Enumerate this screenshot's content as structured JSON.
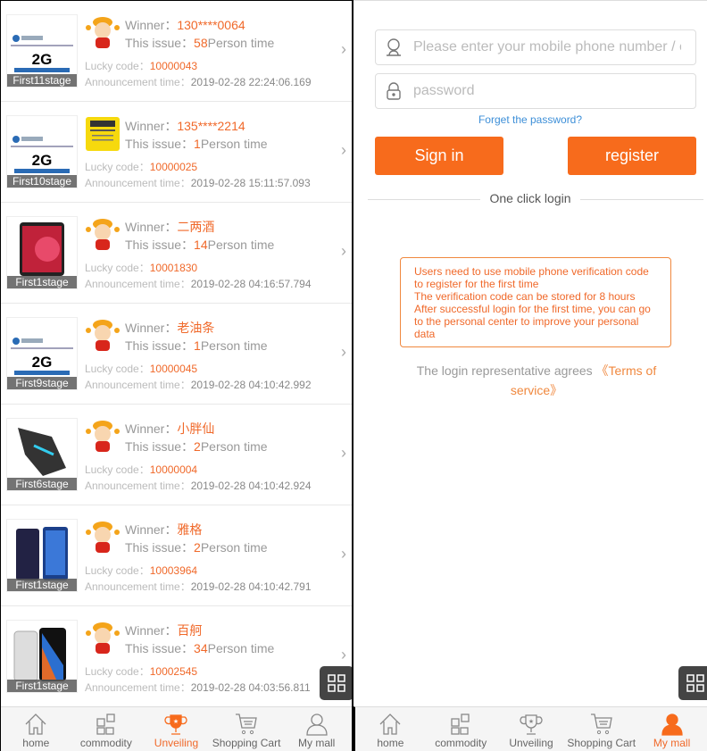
{
  "labels": {
    "winner": "Winner：",
    "issue": "This issue：",
    "person_time": "Person time",
    "lucky": "Lucky code：",
    "announce": "Announcement time："
  },
  "items": [
    {
      "stage": "First11stage",
      "winner": "130****0064",
      "count": "58",
      "code": "10000043",
      "time": "2019-02-28 22:24:06.169",
      "img": "2g-card",
      "avatar": "mascot"
    },
    {
      "stage": "First10stage",
      "winner": "135****2214",
      "count": "1",
      "code": "10000025",
      "time": "2019-02-28 15:11:57.093",
      "img": "2g-card",
      "avatar": "yellow"
    },
    {
      "stage": "First1stage",
      "winner": "二两酒",
      "count": "14",
      "code": "10001830",
      "time": "2019-02-28 04:16:57.794",
      "img": "ipad",
      "avatar": "mascot"
    },
    {
      "stage": "First9stage",
      "winner": "老油条",
      "count": "1",
      "code": "10000045",
      "time": "2019-02-28 04:10:42.992",
      "img": "2g-card",
      "avatar": "mascot"
    },
    {
      "stage": "First6stage",
      "winner": "小胖仙",
      "count": "2",
      "code": "10000004",
      "time": "2019-02-28 04:10:42.924",
      "img": "mouse",
      "avatar": "mascot"
    },
    {
      "stage": "First1stage",
      "winner": "雅格",
      "count": "2",
      "code": "10003964",
      "time": "2019-02-28 04:10:42.791",
      "img": "phone-blue",
      "avatar": "mascot"
    },
    {
      "stage": "First1stage",
      "winner": "百舸",
      "count": "34",
      "code": "10002545",
      "time": "2019-02-28 04:03:56.811",
      "img": "iphone",
      "avatar": "mascot"
    }
  ],
  "nav": [
    {
      "label": "home",
      "icon": "home-icon"
    },
    {
      "label": "commodity",
      "icon": "grid-icon"
    },
    {
      "label": "Unveiling",
      "icon": "trophy-icon"
    },
    {
      "label": "Shopping Cart",
      "icon": "cart-icon"
    },
    {
      "label": "My mall",
      "icon": "user-icon"
    }
  ],
  "left_active_nav": "Unveiling",
  "right_active_nav": "My mall",
  "login": {
    "phone_placeholder": "Please enter your mobile phone number / email",
    "password_placeholder": "password",
    "forgot": "Forget the password?",
    "sign_in": "Sign in",
    "register": "register",
    "one_click": "One click login",
    "notice": [
      "Users need to use mobile phone verification code to register for the first time",
      "The verification code can be stored for 8 hours",
      "After successful login for the first time, you can go to the personal center to improve your personal data"
    ],
    "agree": "The login representative agrees ",
    "terms": "《Terms of service》"
  },
  "colors": {
    "accent": "#f76b1c",
    "link": "#3d8fd8"
  }
}
